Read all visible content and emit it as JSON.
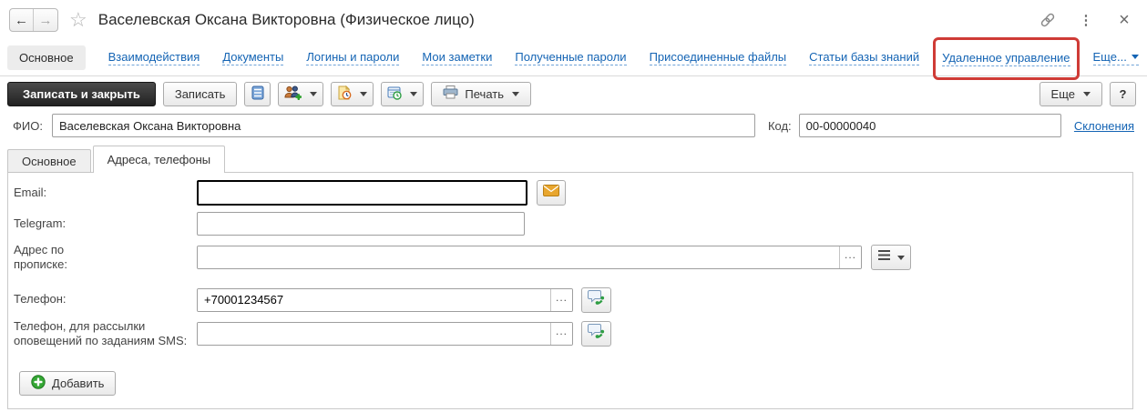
{
  "window": {
    "title": "Васелевская Оксана Викторовна (Физическое лицо)",
    "back_glyph": "←",
    "forward_glyph": "→",
    "star_glyph": "☆",
    "more_dots_glyph": "⋮",
    "close_glyph": "×"
  },
  "nav": {
    "items": [
      {
        "label": "Основное",
        "active": true
      },
      {
        "label": "Взаимодействия"
      },
      {
        "label": "Документы"
      },
      {
        "label": "Логины и пароли"
      },
      {
        "label": "Мои заметки"
      },
      {
        "label": "Полученные пароли"
      },
      {
        "label": "Присоединенные файлы"
      },
      {
        "label": "Статьи базы знаний"
      },
      {
        "label": "Удаленное управление",
        "highlighted": true
      },
      {
        "label": "Еще..."
      }
    ]
  },
  "toolbar": {
    "save_and_close_label": "Записать и закрыть",
    "save_label": "Записать",
    "print_label": "Печать",
    "more_label": "Еще",
    "help_label": "?"
  },
  "record": {
    "fio_label": "ФИО:",
    "fio_value": "Васелевская Оксана Викторовна",
    "code_label": "Код:",
    "code_value": "00-00000040",
    "declensions_label": "Склонения"
  },
  "tabs": {
    "items": [
      {
        "label": "Основное"
      },
      {
        "label": "Адреса, телефоны",
        "active": true
      }
    ]
  },
  "form": {
    "email_label": "Email:",
    "email_value": "",
    "telegram_label": "Telegram:",
    "telegram_value": "",
    "address_label": "Адрес по\nпрописке:",
    "address_value": "",
    "phone_label": "Телефон:",
    "phone_value": "+70001234567",
    "phone_sms_label": "Телефон, для рассылки\nоповещений по заданиям SMS:",
    "phone_sms_value": "",
    "select_button_glyph": "...",
    "add_button_label": "Добавить"
  },
  "colors": {
    "link_blue": "#1464b4",
    "highlight_red": "#cf3b36",
    "focus_border": "#000000",
    "dark_button": "#2b2b2b"
  }
}
